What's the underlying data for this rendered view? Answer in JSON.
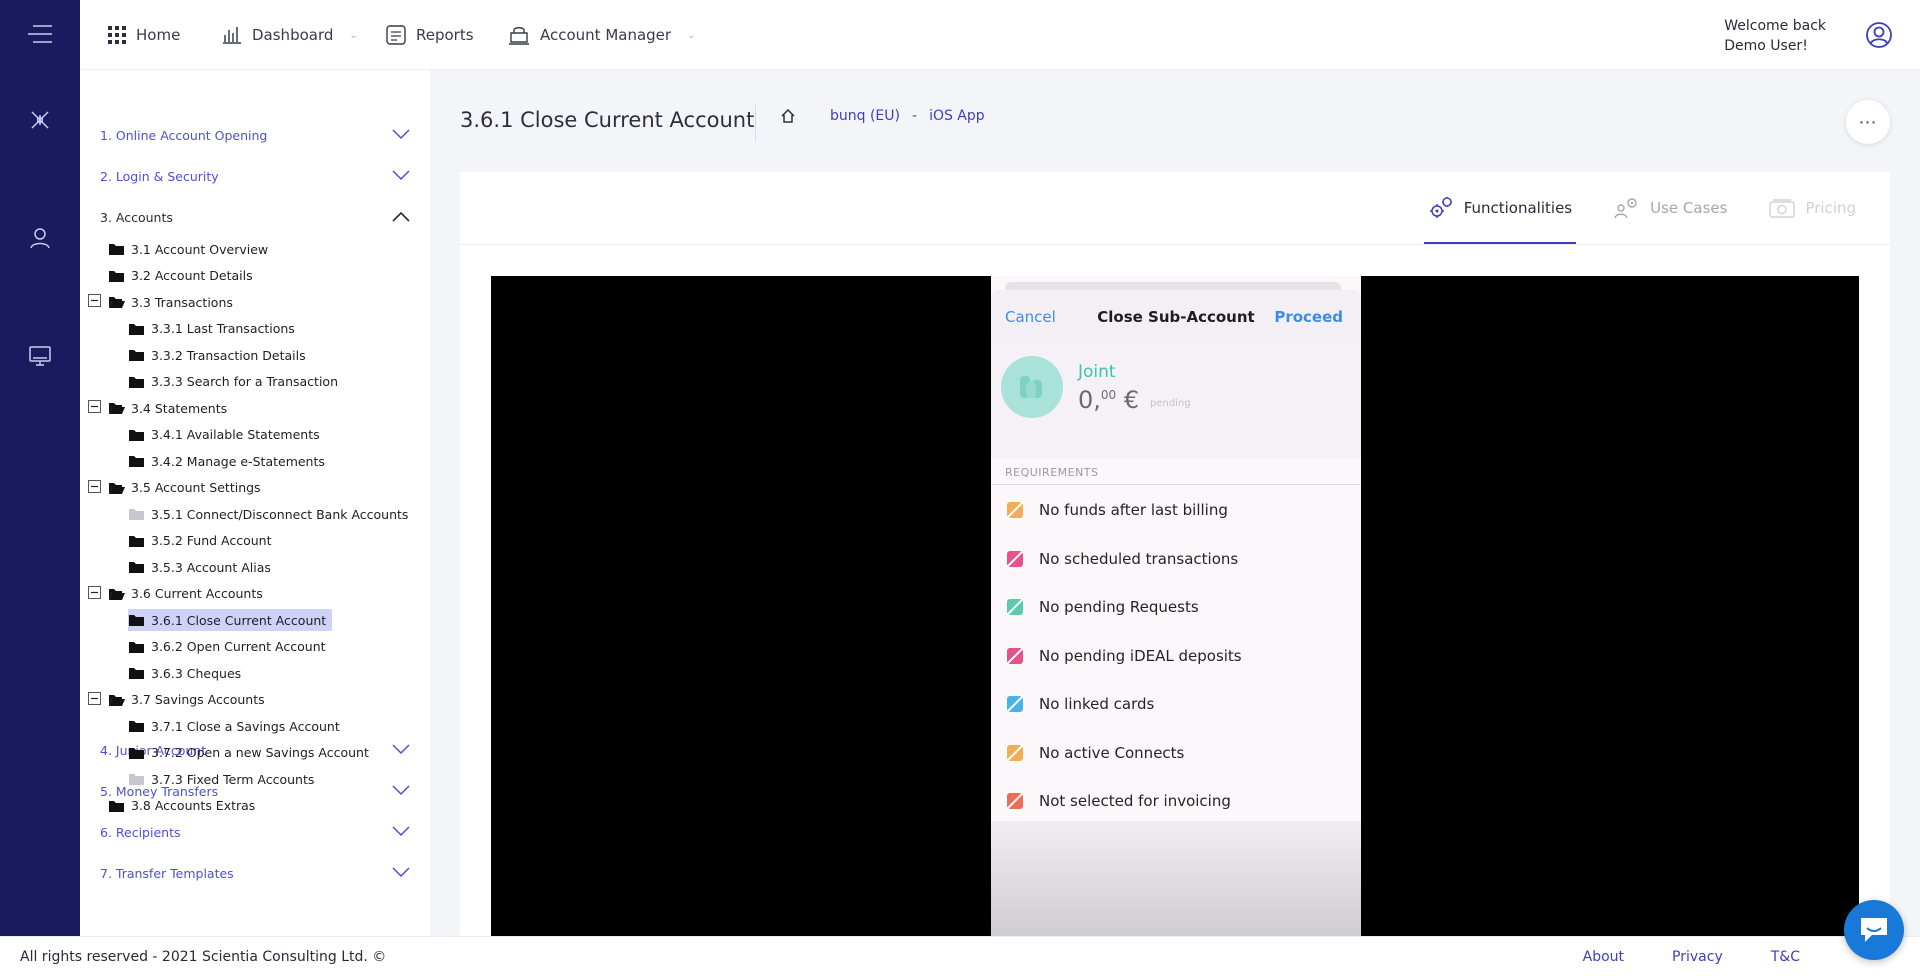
{
  "rail": {
    "items": [
      "menu-icon",
      "network-icon",
      "user-icon",
      "monitor-icon"
    ]
  },
  "topnav": {
    "home": "Home",
    "dashboard": "Dashboard",
    "reports": "Reports",
    "account_manager": "Account Manager",
    "welcome_line1": "Welcome back",
    "welcome_line2": "Demo User!"
  },
  "sidebar": {
    "sections": [
      {
        "label": "1. Online Account Opening",
        "expanded": false
      },
      {
        "label": "2. Login & Security",
        "expanded": false
      },
      {
        "label": "3. Accounts",
        "expanded": true
      },
      {
        "label": "4. Junior Account",
        "expanded": false
      },
      {
        "label": "5. Money Transfers",
        "expanded": false
      },
      {
        "label": "6. Recipients",
        "expanded": false
      },
      {
        "label": "7. Transfer Templates",
        "expanded": false
      }
    ],
    "tree": [
      {
        "label": "3.1 Account Overview",
        "level": 1,
        "folder": "closed"
      },
      {
        "label": "3.2 Account Details",
        "level": 1,
        "folder": "closed"
      },
      {
        "label": "3.3 Transactions",
        "level": 1,
        "folder": "open",
        "toggle": true
      },
      {
        "label": "3.3.1 Last Transactions",
        "level": 2,
        "folder": "closed"
      },
      {
        "label": "3.3.2 Transaction Details",
        "level": 2,
        "folder": "closed"
      },
      {
        "label": "3.3.3 Search for a Transaction",
        "level": 2,
        "folder": "closed"
      },
      {
        "label": "3.4 Statements",
        "level": 1,
        "folder": "open",
        "toggle": true
      },
      {
        "label": "3.4.1 Available Statements",
        "level": 2,
        "folder": "closed"
      },
      {
        "label": "3.4.2 Manage e-Statements",
        "level": 2,
        "folder": "closed"
      },
      {
        "label": "3.5 Account Settings",
        "level": 1,
        "folder": "open",
        "toggle": true
      },
      {
        "label": "3.5.1 Connect/Disconnect Bank Accounts",
        "level": 2,
        "folder": "grey"
      },
      {
        "label": "3.5.2 Fund Account",
        "level": 2,
        "folder": "closed"
      },
      {
        "label": "3.5.3 Account Alias",
        "level": 2,
        "folder": "closed"
      },
      {
        "label": "3.6 Current Accounts",
        "level": 1,
        "folder": "open",
        "toggle": true
      },
      {
        "label": "3.6.1 Close Current Account",
        "level": 2,
        "folder": "closed",
        "selected": true
      },
      {
        "label": "3.6.2 Open Current Account",
        "level": 2,
        "folder": "closed"
      },
      {
        "label": "3.6.3 Cheques",
        "level": 2,
        "folder": "closed"
      },
      {
        "label": "3.7 Savings Accounts",
        "level": 1,
        "folder": "open",
        "toggle": true
      },
      {
        "label": "3.7.1 Close a Savings Account",
        "level": 2,
        "folder": "closed"
      },
      {
        "label": "3.7.2 Open a new Savings Account",
        "level": 2,
        "folder": "closed"
      },
      {
        "label": "3.7.3 Fixed Term Accounts",
        "level": 2,
        "folder": "grey"
      },
      {
        "label": "3.8 Accounts Extras",
        "level": 1,
        "folder": "closed"
      }
    ]
  },
  "page": {
    "title": "3.6.1 Close Current Account",
    "breadcrumb_bank": "bunq (EU)",
    "breadcrumb_sep": "-",
    "breadcrumb_app": "iOS App"
  },
  "tabs": [
    {
      "label": "Functionalities",
      "state": "active",
      "icon": "gears-icon"
    },
    {
      "label": "Use Cases",
      "state": "inactive",
      "icon": "people-cog-icon"
    },
    {
      "label": "Pricing",
      "state": "disabled",
      "icon": "money-icon"
    }
  ],
  "phone": {
    "cancel": "Cancel",
    "title": "Close Sub-Account",
    "proceed": "Proceed",
    "account_name": "Joint",
    "balance_main": "0,",
    "balance_cents": "00",
    "balance_currency": "€",
    "pending": "pending",
    "requirements_header": "REQUIREMENTS",
    "requirements": [
      {
        "label": "No funds after last billing",
        "color": "#f0a13a"
      },
      {
        "label": "No scheduled transactions",
        "color": "#e0357a"
      },
      {
        "label": "No pending Requests",
        "color": "#3cc3a0"
      },
      {
        "label": "No pending iDEAL deposits",
        "color": "#e0357a"
      },
      {
        "label": "No linked cards",
        "color": "#2aa6e0"
      },
      {
        "label": "No active Connects",
        "color": "#f0a13a"
      },
      {
        "label": "Not selected for invoicing",
        "color": "#e8553a"
      }
    ]
  },
  "footer": {
    "copyright": "All rights reserved - 2021 Scientia Consulting Ltd. ©",
    "about": "About",
    "privacy": "Privacy",
    "tc": "T&C"
  },
  "colors": {
    "rail": "#1a1a5e",
    "accent": "#3d3fbf",
    "link": "#4c50d6",
    "selected": "#cfd2f7",
    "chat": "#1879d8"
  }
}
